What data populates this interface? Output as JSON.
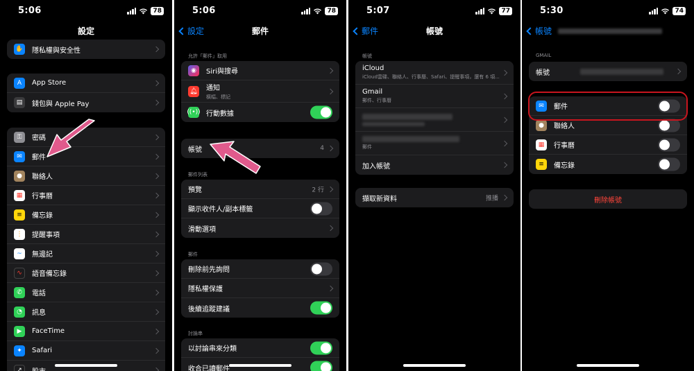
{
  "s1": {
    "time": "5:06",
    "battery": "78",
    "title": "設定",
    "g0": [
      "隱私權與安全性"
    ],
    "g1": [
      "App Store",
      "錢包與 Apple Pay"
    ],
    "g2": [
      "密碼",
      "郵件",
      "聯絡人",
      "行事曆",
      "備忘錄",
      "提醒事項",
      "無邊記",
      "語音備忘錄",
      "電話",
      "訊息",
      "FaceTime",
      "Safari",
      "股市"
    ]
  },
  "s2": {
    "time": "5:06",
    "battery": "78",
    "back": "設定",
    "title": "郵件",
    "allow_header": "允許「郵件」取用",
    "allow": [
      {
        "label": "Siri與搜尋",
        "sub": ""
      },
      {
        "label": "通知",
        "sub": "橫幅、標記"
      },
      {
        "label": "行動數據",
        "sub": ""
      }
    ],
    "accounts_label": "帳號",
    "accounts_count": "4",
    "list_header": "郵件列表",
    "list": [
      {
        "label": "預覽",
        "value": "2 行"
      },
      {
        "label": "顯示收件人/副本標籤",
        "value": ""
      },
      {
        "label": "滑動選項",
        "value": ""
      }
    ],
    "mail_header": "郵件",
    "mail": [
      "刪除前先詢問",
      "隱私權保護",
      "後續追蹤建議"
    ],
    "thread_header": "討論串",
    "thread": [
      "以討論串來分類",
      "收合已讀郵件"
    ]
  },
  "s3": {
    "time": "5:07",
    "battery": "77",
    "back": "郵件",
    "title": "帳號",
    "header": "帳號",
    "accounts": [
      {
        "label": "iCloud",
        "sub": "iCloud雲碟、聯絡人、行事曆、Safari、提醒事項，還有 6 項..."
      },
      {
        "label": "Gmail",
        "sub": "郵件、行事曆"
      },
      {
        "label": "",
        "sub": ""
      },
      {
        "label": "",
        "sub": "郵件"
      }
    ],
    "add_account": "加入帳號",
    "fetch_label": "擷取新資料",
    "fetch_value": "推播"
  },
  "s4": {
    "time": "5:30",
    "battery": "74",
    "back": "帳號",
    "header": "GMAIL",
    "account_label": "帳號",
    "toggles": [
      "郵件",
      "聯絡人",
      "行事曆",
      "備忘錄"
    ],
    "delete_label": "刪除帳號"
  },
  "colors": {
    "accent": "#0a84ff",
    "toggle_on": "#30d158",
    "destructive": "#ff453a",
    "highlight": "#c9151e",
    "arrow": "#e05a8c"
  }
}
